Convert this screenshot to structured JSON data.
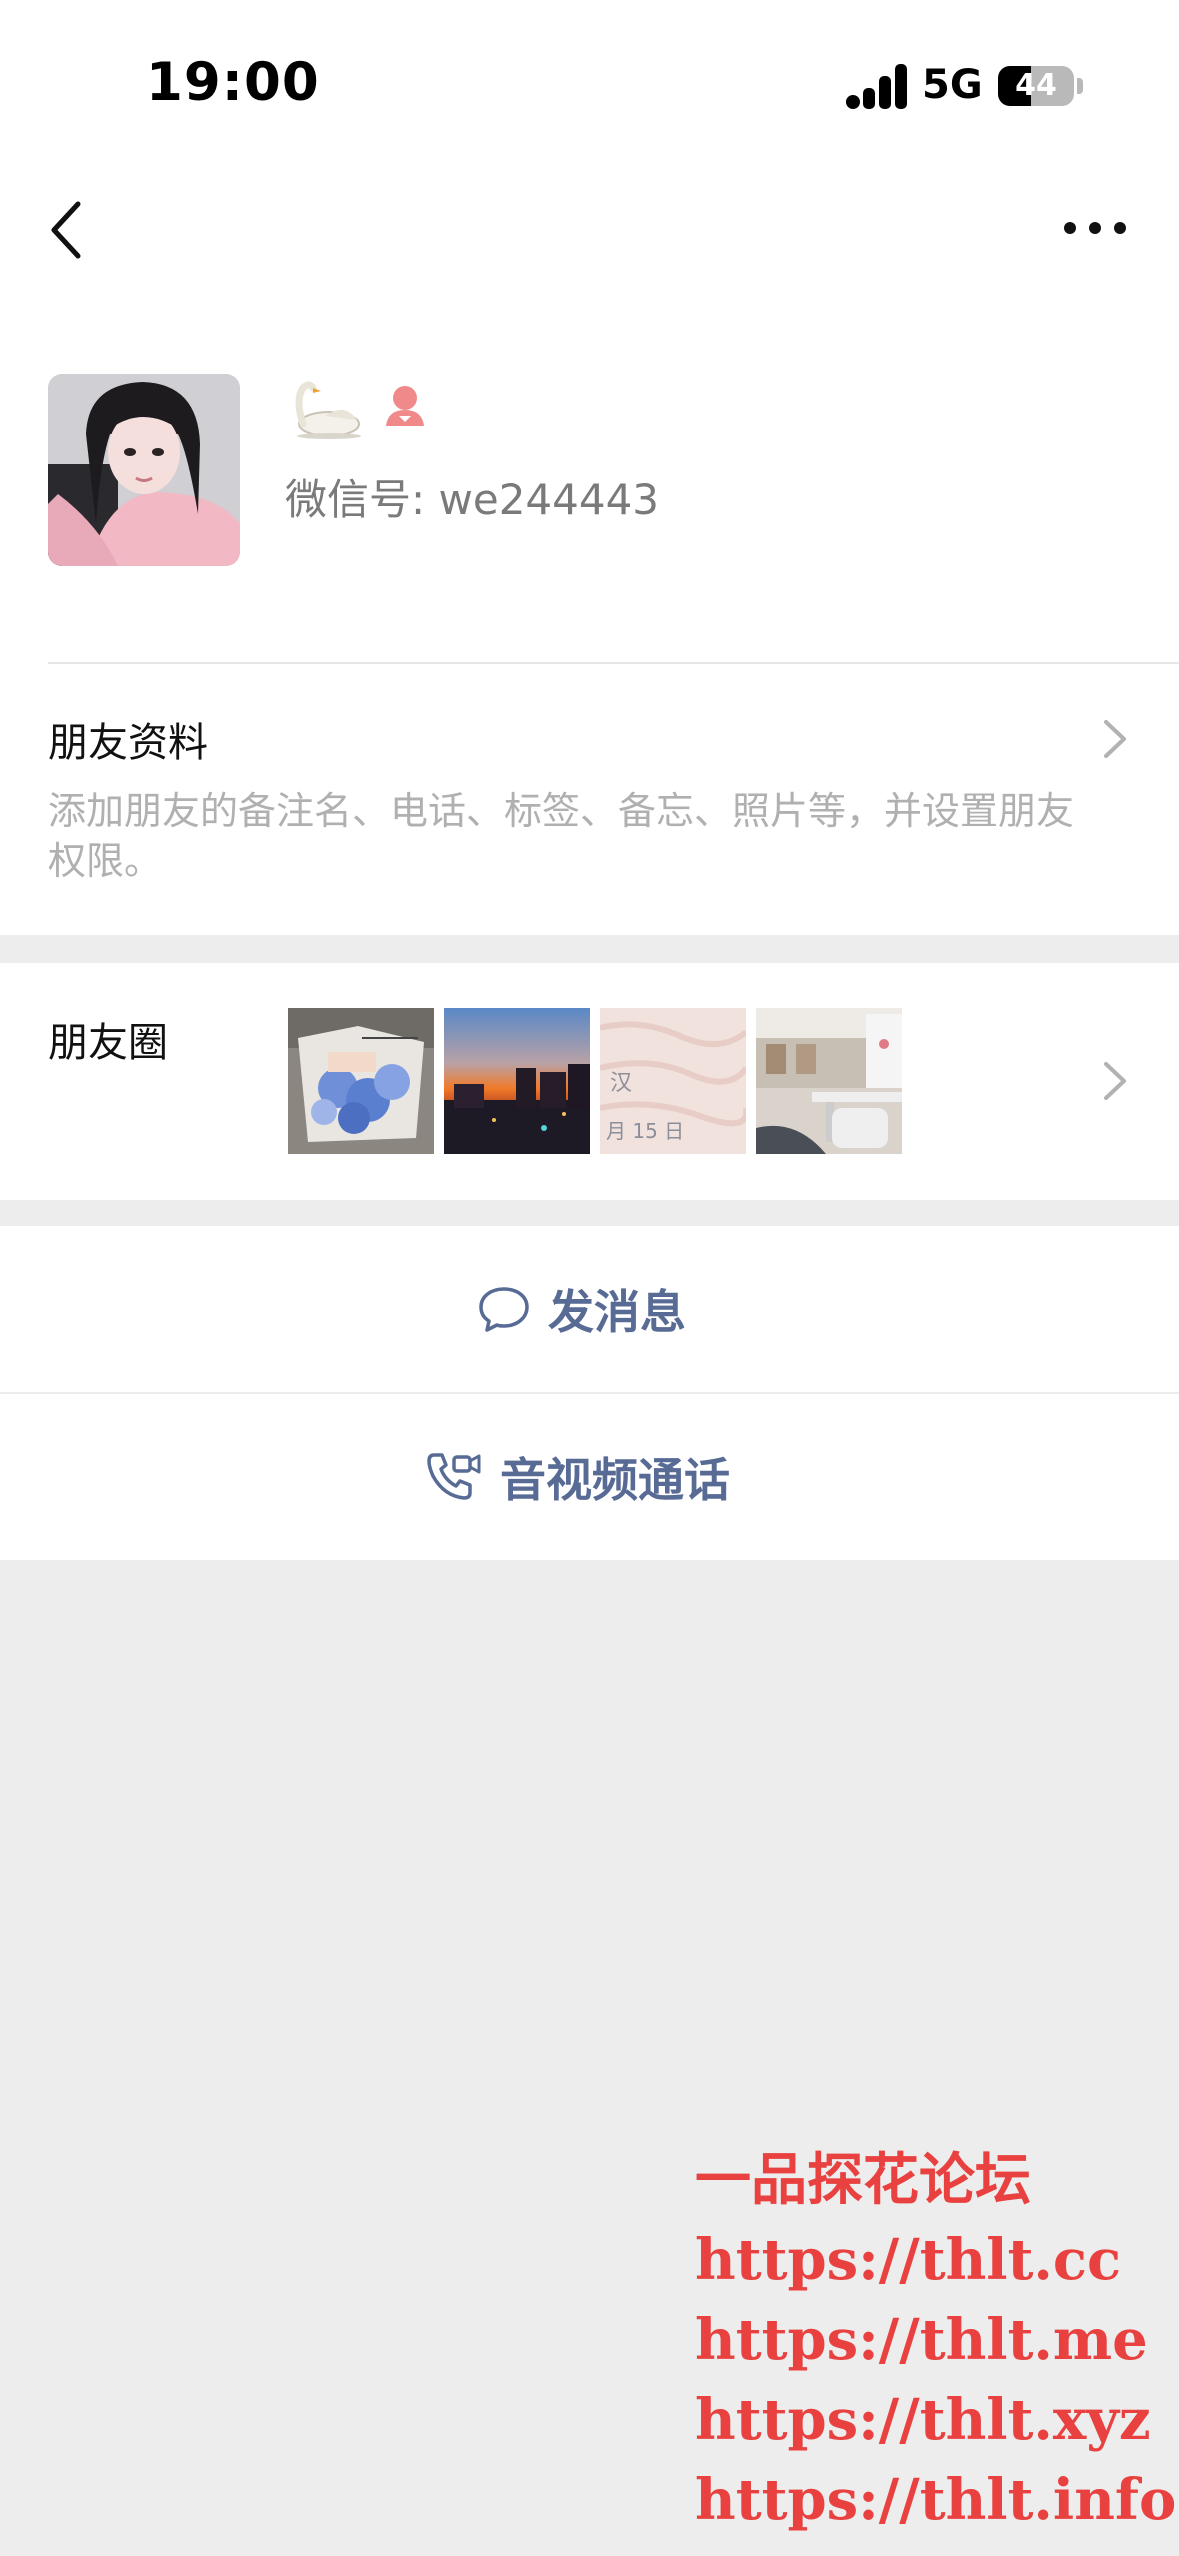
{
  "status_bar": {
    "time": "19:00",
    "network": "5G",
    "battery": "44",
    "battery_level": 0.44
  },
  "profile": {
    "wechat_id": "微信号: we244443"
  },
  "friend_info": {
    "title": "朋友资料",
    "description": "添加朋友的备注名、电话、标签、备忘、照片等，并设置朋友权限。"
  },
  "moments": {
    "label": "朋友圈",
    "thumbnails": [
      {
        "kind": "flower-bouquet-photo"
      },
      {
        "kind": "city-sunset-photo"
      },
      {
        "kind": "ticket-photo",
        "text_1": "汉",
        "text_2": "月 15 日"
      },
      {
        "kind": "restaurant-photo"
      }
    ]
  },
  "actions": {
    "message": "发消息",
    "call": "音视频通话"
  },
  "watermark": [
    "一品探花论坛",
    "https://thlt.cc",
    "https://thlt.me",
    "https://thlt.xyz",
    "https://thlt.info"
  ],
  "colors": {
    "link_blue": "#576b95",
    "watermark_red": "#e8413f",
    "gender_pink": "#f08a8a"
  }
}
